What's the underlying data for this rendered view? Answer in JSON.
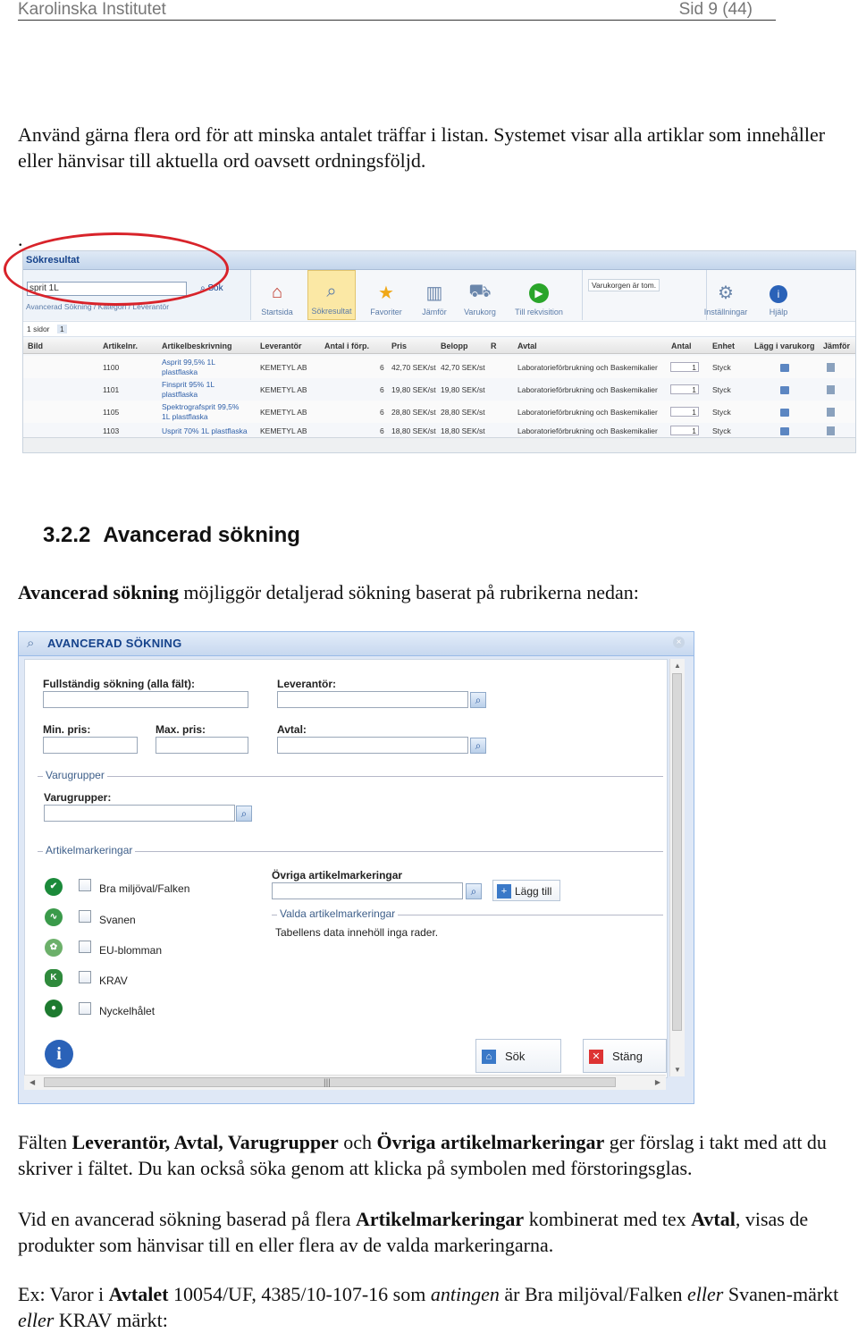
{
  "header": {
    "left": "Karolinska Institutet",
    "right": "Sid 9 (44)"
  },
  "intro": "Använd gärna flera ord för att minska antalet träffar i listan. Systemet visar alla artiklar som innehåller eller hänvisar till aktuella ord oavsett ordningsföljd.",
  "dot": ".",
  "shot1": {
    "title": "Sökresultat",
    "search_value": "sprit 1L",
    "search_button": "Sök",
    "crumbs": "Avancerad Sökning / Kategori / Leverantör",
    "toolbar": [
      {
        "label": "Startsida",
        "icon": "home-icon"
      },
      {
        "label": "Sökresultat",
        "icon": "magnifier-icon"
      },
      {
        "label": "Favoriter",
        "icon": "star-icon"
      },
      {
        "label": "Jämför",
        "icon": "compare-icon"
      },
      {
        "label": "Varukorg",
        "icon": "cart-icon"
      },
      {
        "label": "Till rekvisition",
        "icon": "play-icon"
      }
    ],
    "cart_text": "Varukorgen är tom.",
    "settings_label": "Inställningar",
    "help_label": "Hjälp",
    "pages_label": "1 sidor",
    "page_num": "1",
    "columns": [
      "Bild",
      "Artikelnr.",
      "Artikelbeskrivning",
      "Leverantör",
      "Antal i förp.",
      "Pris",
      "Belopp",
      "R",
      "Avtal",
      "Antal",
      "Enhet",
      "Lägg i varukorg",
      "Jämför"
    ],
    "rows": [
      {
        "nr": "1100",
        "desc": "Asprit 99,5% 1L plastflaska",
        "lev": "KEMETYL AB",
        "antal": "6",
        "pris": "42,70 SEK/st",
        "belopp": "42,70 SEK/st",
        "avtal": "Laboratorieförbrukning och Baskemikalier",
        "qty": "1",
        "enhet": "Styck"
      },
      {
        "nr": "1101",
        "desc": "Finsprit 95% 1L plastflaska",
        "lev": "KEMETYL AB",
        "antal": "6",
        "pris": "19,80 SEK/st",
        "belopp": "19,80 SEK/st",
        "avtal": "Laboratorieförbrukning och Baskemikalier",
        "qty": "1",
        "enhet": "Styck"
      },
      {
        "nr": "1105",
        "desc": "Spektrografsprit 99,5% 1L plastflaska",
        "lev": "KEMETYL AB",
        "antal": "6",
        "pris": "28,80 SEK/st",
        "belopp": "28,80 SEK/st",
        "avtal": "Laboratorieförbrukning och Baskemikalier",
        "qty": "1",
        "enhet": "Styck"
      },
      {
        "nr": "1103",
        "desc": "Usprit 70% 1L plastflaska",
        "lev": "KEMETYL AB",
        "antal": "6",
        "pris": "18,80 SEK/st",
        "belopp": "18,80 SEK/st",
        "avtal": "Laboratorieförbrukning och Baskemikalier",
        "qty": "1",
        "enhet": "Styck"
      }
    ]
  },
  "section": {
    "number": "3.2.2",
    "title": "Avancerad sökning"
  },
  "adv_intro": {
    "bold": "Avancerad sökning",
    "rest": " möjliggör detaljerad sökning baserat på rubrikerna nedan:"
  },
  "dialog": {
    "title": "AVANCERAD SÖKNING",
    "full_search_label": "Fullständig sökning (alla fält):",
    "supplier_label": "Leverantör:",
    "min_price_label": "Min. pris:",
    "max_price_label": "Max. pris:",
    "agreement_label": "Avtal:",
    "groups_legend": "Varugrupper",
    "groups_label": "Varugrupper:",
    "markings_legend": "Artikelmarkeringar",
    "markings": [
      {
        "label": "Bra miljöval/Falken",
        "color": "#1b8a3a"
      },
      {
        "label": "Svanen",
        "color": "#3a9a4a"
      },
      {
        "label": "EU-blomman",
        "color": "#6cb06a"
      },
      {
        "label": "KRAV",
        "color": "#2f8a3c"
      },
      {
        "label": "Nyckelhålet",
        "color": "#1d7a2f"
      }
    ],
    "other_label": "Övriga artikelmarkeringar",
    "add_button": "Lägg till",
    "selected_legend": "Valda artikelmarkeringar",
    "empty_text": "Tabellens data innehöll inga rader.",
    "search_button": "Sök",
    "close_button": "Stäng"
  },
  "body1": {
    "a": "Fälten ",
    "b": "Leverantör, Avtal, Varugrupper",
    "c": " och ",
    "d": "Övriga artikelmarkeringar",
    "e": " ger förslag i takt med att du skriver i fältet. Du kan också söka genom att klicka på symbolen med förstoringsglas."
  },
  "body2": {
    "a": "Vid en avancerad sökning baserad på flera ",
    "b": "Artikelmarkeringar",
    "c": " kombinerat med tex ",
    "d": "Avtal",
    "e": ", visas de produkter som hänvisar till en eller flera av de valda markeringarna."
  },
  "body3": {
    "a": "Ex: Varor i ",
    "b": "Avtalet",
    "c": " 10054/UF, 4385/10-107-16 som ",
    "d": "antingen",
    "e": " är Bra miljöval/Falken ",
    "f": "eller",
    "g": " Svanen-märkt ",
    "h": "eller",
    "i": " KRAV märkt:"
  }
}
